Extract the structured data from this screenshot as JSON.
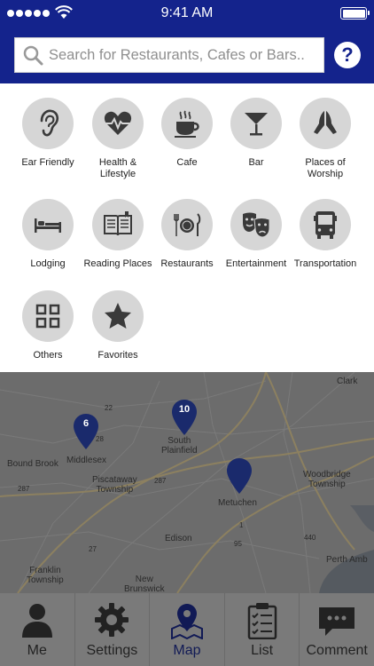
{
  "status_bar": {
    "time": "9:41 AM"
  },
  "search": {
    "placeholder": "Search for Restaurants, Cafes or Bars.."
  },
  "help": {
    "label": "?"
  },
  "categories": [
    {
      "label": "Ear Friendly",
      "icon": "ear-icon"
    },
    {
      "label": "Health &\nLifestyle",
      "icon": "heart-pulse-icon"
    },
    {
      "label": "Cafe",
      "icon": "coffee-cup-icon"
    },
    {
      "label": "Bar",
      "icon": "cocktail-glass-icon"
    },
    {
      "label": "Places of\nWorship",
      "icon": "praying-hands-icon"
    },
    {
      "label": "Lodging",
      "icon": "bed-icon"
    },
    {
      "label": "Reading Places",
      "icon": "open-book-icon"
    },
    {
      "label": "Restaurants",
      "icon": "plate-cutlery-icon"
    },
    {
      "label": "Entertainment",
      "icon": "theater-masks-icon"
    },
    {
      "label": "Transportation",
      "icon": "bus-icon"
    },
    {
      "label": "Others",
      "icon": "grid-icon"
    },
    {
      "label": "Favorites",
      "icon": "star-icon"
    }
  ],
  "map": {
    "places": {
      "clark": "Clark",
      "middlesex": "Middlesex",
      "south_plainfield": "South\nPlainfield",
      "bound_brook": "Bound Brook",
      "piscataway": "Piscataway\nTownship",
      "metuchen": "Metuchen",
      "woodbridge": "Woodbridge\nTownship",
      "edison": "Edison",
      "franklin": "Franklin\nTownship",
      "new_brunswick": "New\nBrunswick",
      "perth_amboy": "Perth Amb"
    },
    "routes": {
      "r22": "22",
      "r28": "28",
      "r287": "287",
      "r287b": "287",
      "r440": "440",
      "r1": "1",
      "r95": "95",
      "r27": "27"
    },
    "pins": [
      {
        "count": "6"
      },
      {
        "count": "10"
      },
      {
        "count": ""
      }
    ]
  },
  "tabs": [
    {
      "label": "Me",
      "icon": "person-icon"
    },
    {
      "label": "Settings",
      "icon": "gear-icon"
    },
    {
      "label": "Map",
      "icon": "map-pin-icon"
    },
    {
      "label": "List",
      "icon": "checklist-icon"
    },
    {
      "label": "Comment",
      "icon": "chat-bubble-icon"
    }
  ],
  "colors": {
    "brand": "#14238c",
    "pin": "#1a2a6c",
    "map_overlay": "#6c6c6c"
  }
}
